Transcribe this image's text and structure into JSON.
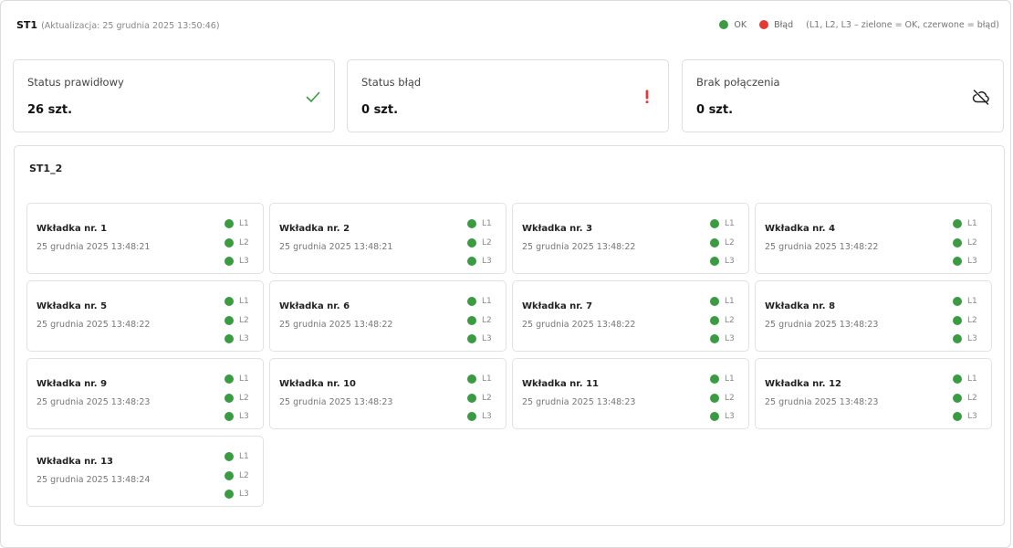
{
  "header": {
    "title": "ST1",
    "subtitle": "(Aktualizacja: 25 grudnia 2025 13:50:46)",
    "legend": {
      "ok_label": "OK",
      "ok_color": "#3a9b43",
      "err_label": "Błąd",
      "err_color": "#e53935",
      "note": "(L1, L2, L3 – zielone = OK, czerwone = błąd)"
    }
  },
  "cards": [
    {
      "label": "Status prawidłowy",
      "value": "26 szt.",
      "icon": "check-icon"
    },
    {
      "label": "Status błąd",
      "value": "0 szt.",
      "icon": "exclamation-icon"
    },
    {
      "label": "Brak połączenia",
      "value": "0 szt.",
      "icon": "cloud-off-icon"
    }
  ],
  "section": {
    "title": "ST1_2",
    "tiles": [
      {
        "name": "Wkładka nr. 1",
        "time": "25 grudnia 2025 13:48:21",
        "lines": [
          {
            "label": "L1",
            "status": "ok"
          },
          {
            "label": "L2",
            "status": "ok"
          },
          {
            "label": "L3",
            "status": "ok"
          }
        ]
      },
      {
        "name": "Wkładka nr. 2",
        "time": "25 grudnia 2025 13:48:21",
        "lines": [
          {
            "label": "L1",
            "status": "ok"
          },
          {
            "label": "L2",
            "status": "ok"
          },
          {
            "label": "L3",
            "status": "ok"
          }
        ]
      },
      {
        "name": "Wkładka nr. 3",
        "time": "25 grudnia 2025 13:48:22",
        "lines": [
          {
            "label": "L1",
            "status": "ok"
          },
          {
            "label": "L2",
            "status": "ok"
          },
          {
            "label": "L3",
            "status": "ok"
          }
        ]
      },
      {
        "name": "Wkładka nr. 4",
        "time": "25 grudnia 2025 13:48:22",
        "lines": [
          {
            "label": "L1",
            "status": "ok"
          },
          {
            "label": "L2",
            "status": "ok"
          },
          {
            "label": "L3",
            "status": "ok"
          }
        ]
      },
      {
        "name": "Wkładka nr. 5",
        "time": "25 grudnia 2025 13:48:22",
        "lines": [
          {
            "label": "L1",
            "status": "ok"
          },
          {
            "label": "L2",
            "status": "ok"
          },
          {
            "label": "L3",
            "status": "ok"
          }
        ]
      },
      {
        "name": "Wkładka nr. 6",
        "time": "25 grudnia 2025 13:48:22",
        "lines": [
          {
            "label": "L1",
            "status": "ok"
          },
          {
            "label": "L2",
            "status": "ok"
          },
          {
            "label": "L3",
            "status": "ok"
          }
        ]
      },
      {
        "name": "Wkładka nr. 7",
        "time": "25 grudnia 2025 13:48:22",
        "lines": [
          {
            "label": "L1",
            "status": "ok"
          },
          {
            "label": "L2",
            "status": "ok"
          },
          {
            "label": "L3",
            "status": "ok"
          }
        ]
      },
      {
        "name": "Wkładka nr. 8",
        "time": "25 grudnia 2025 13:48:23",
        "lines": [
          {
            "label": "L1",
            "status": "ok"
          },
          {
            "label": "L2",
            "status": "ok"
          },
          {
            "label": "L3",
            "status": "ok"
          }
        ]
      },
      {
        "name": "Wkładka nr. 9",
        "time": "25 grudnia 2025 13:48:23",
        "lines": [
          {
            "label": "L1",
            "status": "ok"
          },
          {
            "label": "L2",
            "status": "ok"
          },
          {
            "label": "L3",
            "status": "ok"
          }
        ]
      },
      {
        "name": "Wkładka nr. 10",
        "time": "25 grudnia 2025 13:48:23",
        "lines": [
          {
            "label": "L1",
            "status": "ok"
          },
          {
            "label": "L2",
            "status": "ok"
          },
          {
            "label": "L3",
            "status": "ok"
          }
        ]
      },
      {
        "name": "Wkładka nr. 11",
        "time": "25 grudnia 2025 13:48:23",
        "lines": [
          {
            "label": "L1",
            "status": "ok"
          },
          {
            "label": "L2",
            "status": "ok"
          },
          {
            "label": "L3",
            "status": "ok"
          }
        ]
      },
      {
        "name": "Wkładka nr. 12",
        "time": "25 grudnia 2025 13:48:23",
        "lines": [
          {
            "label": "L1",
            "status": "ok"
          },
          {
            "label": "L2",
            "status": "ok"
          },
          {
            "label": "L3",
            "status": "ok"
          }
        ]
      },
      {
        "name": "Wkładka nr. 13",
        "time": "25 grudnia 2025 13:48:24",
        "lines": [
          {
            "label": "L1",
            "status": "ok"
          },
          {
            "label": "L2",
            "status": "ok"
          },
          {
            "label": "L3",
            "status": "ok"
          }
        ]
      }
    ]
  }
}
